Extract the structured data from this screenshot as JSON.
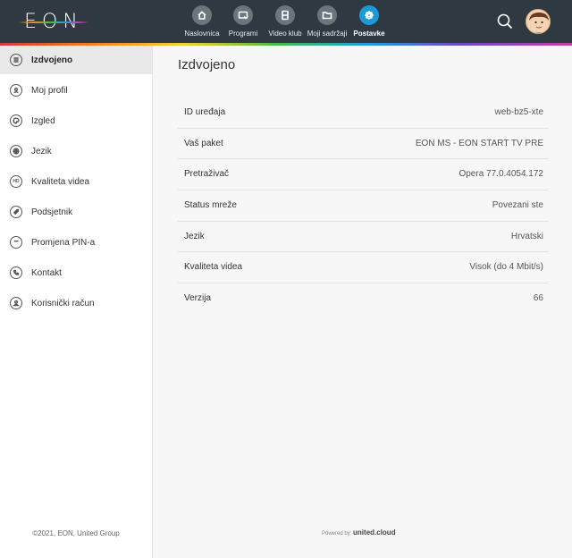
{
  "header": {
    "logo_text": "EON",
    "nav": [
      {
        "label": "Naslovnica",
        "icon": "home-icon"
      },
      {
        "label": "Programi",
        "icon": "tv-programs-icon"
      },
      {
        "label": "Video klub",
        "icon": "film-icon"
      },
      {
        "label": "Moji sadržaji",
        "icon": "folder-icon"
      },
      {
        "label": "Postavke",
        "icon": "gear-icon",
        "active": true
      }
    ],
    "accent_color": "#1a9ad6",
    "background_color": "#2e3941"
  },
  "sidebar": {
    "items": [
      {
        "label": "Izdvojeno",
        "icon": "list-icon",
        "active": true
      },
      {
        "label": "Moj profil",
        "icon": "profile-icon"
      },
      {
        "label": "Izgled",
        "icon": "palette-icon"
      },
      {
        "label": "Jezik",
        "icon": "globe-icon"
      },
      {
        "label": "Kvaliteta videa",
        "icon": "hd-icon"
      },
      {
        "label": "Podsjetnik",
        "icon": "rocket-icon"
      },
      {
        "label": "Promjena PIN-a",
        "icon": "pin-dots-icon"
      },
      {
        "label": "Kontakt",
        "icon": "phone-icon"
      },
      {
        "label": "Korisnički račun",
        "icon": "user-account-icon"
      }
    ],
    "copyright": "©2021, EON, United Group"
  },
  "main": {
    "title": "Izdvojeno",
    "rows": [
      {
        "key": "ID uređaja",
        "value": "web-bz5-xte"
      },
      {
        "key": "Vaš paket",
        "value": "EON MS - EON START TV PRE"
      },
      {
        "key": "Pretraživač",
        "value": "Opera 77.0.4054.172"
      },
      {
        "key": "Status mreže",
        "value": "Povezani ste"
      },
      {
        "key": "Jezik",
        "value": "Hrvatski"
      },
      {
        "key": "Kvaliteta videa",
        "value": "Visok (do 4 Mbit/s)"
      },
      {
        "key": "Verzija",
        "value": "66"
      }
    ],
    "powered_prefix": "Powered by:",
    "powered_brand": "united.cloud"
  }
}
